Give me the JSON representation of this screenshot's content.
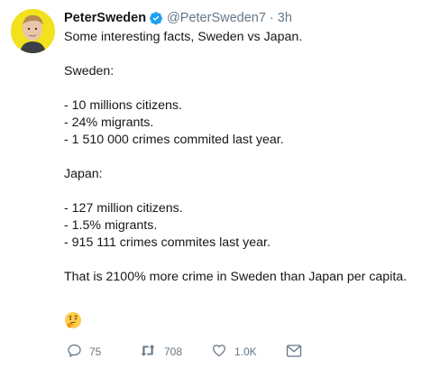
{
  "tweet": {
    "author": {
      "name": "PeterSweden",
      "handle": "@PeterSweden7",
      "separator": "·",
      "time": "3h"
    },
    "lines": [
      "Some interesting facts, Sweden vs Japan.",
      "",
      "Sweden:",
      "",
      "- 10 millions citizens.",
      "- 24% migrants.",
      "- 1 510 000 crimes commited last year.",
      "",
      "Japan:",
      "",
      "- 127 million citizens.",
      "- 1.5% migrants.",
      "- 915 111 crimes commites last year.",
      "",
      "That is 2100% more crime in Sweden than Japan per capita."
    ],
    "emoji": "thinking-face",
    "stats": {
      "replies": "75",
      "retweets": "708",
      "likes": "1.0K"
    }
  },
  "icons": {
    "verified": "verified-badge-icon",
    "reply": "reply-icon",
    "retweet": "retweet-icon",
    "like": "heart-icon",
    "dm": "envelope-icon"
  },
  "colors": {
    "text": "#14171a",
    "secondary": "#657786",
    "verified": "#1da1f2",
    "avatar_bg": "#f1e21d"
  }
}
